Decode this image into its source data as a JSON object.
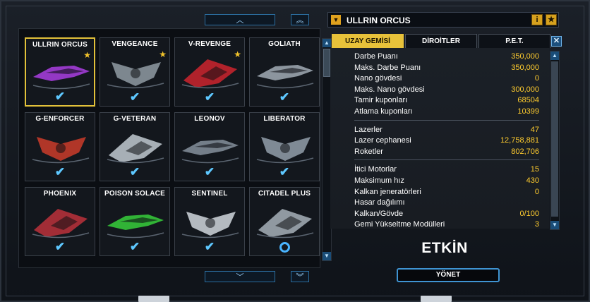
{
  "grid": {
    "ships": [
      {
        "name": "ULLRIN ORCUS",
        "selected": true,
        "favorite": true,
        "status": "check",
        "color": "#a33cd8"
      },
      {
        "name": "VENGEANCE",
        "selected": false,
        "favorite": true,
        "status": "check",
        "color": "#8a939c"
      },
      {
        "name": "V-REVENGE",
        "selected": false,
        "favorite": true,
        "status": "check",
        "color": "#c3242e"
      },
      {
        "name": "GOLIATH",
        "selected": false,
        "favorite": false,
        "status": "check",
        "color": "#9aa3ad"
      },
      {
        "name": "G-ENFORCER",
        "selected": false,
        "favorite": false,
        "status": "check",
        "color": "#c23a2a"
      },
      {
        "name": "G-VETERAN",
        "selected": false,
        "favorite": false,
        "status": "check",
        "color": "#b8c0c8"
      },
      {
        "name": "LEONOV",
        "selected": false,
        "favorite": false,
        "status": "check",
        "color": "#7f8a96"
      },
      {
        "name": "LIBERATOR",
        "selected": false,
        "favorite": false,
        "status": "check",
        "color": "#8c97a3"
      },
      {
        "name": "PHOENIX",
        "selected": false,
        "favorite": false,
        "status": "check",
        "color": "#b3303a"
      },
      {
        "name": "POISON SOLACE",
        "selected": false,
        "favorite": false,
        "status": "check",
        "color": "#35c43a"
      },
      {
        "name": "SENTINEL",
        "selected": false,
        "favorite": false,
        "status": "check",
        "color": "#c7ccd3"
      },
      {
        "name": "CITADEL PLUS",
        "selected": false,
        "favorite": false,
        "status": "ring",
        "color": "#9ea7b0"
      }
    ],
    "scroll_up_icon": "chevron-up-icon",
    "scroll_top_icon": "double-chevron-up-icon",
    "scroll_down_icon": "chevron-down-icon",
    "scroll_bottom_icon": "double-chevron-down-icon"
  },
  "header": {
    "selected_ship": "ULLRIN ORCUS",
    "info_label": "i",
    "fav_label": "★"
  },
  "tabs": [
    {
      "label": "UZAY GEMİSİ",
      "active": true
    },
    {
      "label": "DİROİTLER",
      "active": false
    },
    {
      "label": "P.E.T.",
      "active": false
    }
  ],
  "stats": {
    "group1": [
      {
        "label": "Darbe Puanı",
        "value": "350,000"
      },
      {
        "label": "Maks. Darbe Puanı",
        "value": "350,000"
      },
      {
        "label": "Nano gövdesi",
        "value": "0"
      },
      {
        "label": "Maks. Nano gövdesi",
        "value": "300,000"
      },
      {
        "label": "Tamir kuponları",
        "value": "68504"
      },
      {
        "label": "Atlama kuponları",
        "value": "10399"
      }
    ],
    "group2": [
      {
        "label": "Lazerler",
        "value": "47"
      },
      {
        "label": "Lazer cephanesi",
        "value": "12,758,881"
      },
      {
        "label": "Roketler",
        "value": "802,706"
      }
    ],
    "group3": [
      {
        "label": "İtici Motorlar",
        "value": "15"
      },
      {
        "label": "Maksimum hız",
        "value": "430"
      },
      {
        "label": "Kalkan jeneratörleri",
        "value": "0"
      },
      {
        "label": "Hasar dağılımı",
        "value": ""
      },
      {
        "label": "Kalkan/Gövde",
        "value": "0/100"
      },
      {
        "label": "Gemi Yükseltme Modülleri",
        "value": "3"
      }
    ]
  },
  "status_text": "ETKİN",
  "manage_label": "YÖNET",
  "colors": {
    "accent": "#e8c23a",
    "value": "#ffcc2e",
    "check": "#5ec8ff"
  }
}
